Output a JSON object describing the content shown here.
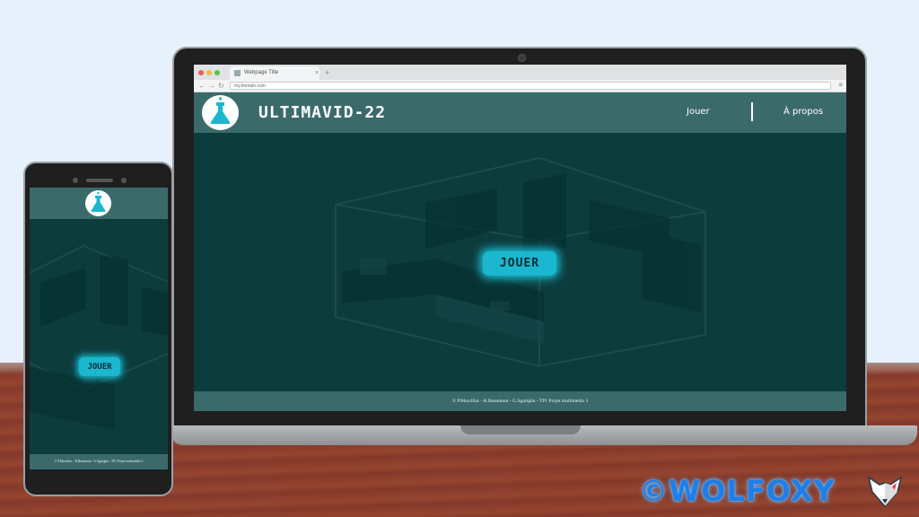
{
  "browser": {
    "tab_title": "Webpage Title",
    "url": "my.domain.com"
  },
  "site": {
    "title": "ULTIMAVID-22",
    "nav": [
      {
        "label": "Jouer"
      },
      {
        "label": "À propos"
      }
    ],
    "play_button": "JOUER",
    "footer": "© P.Marcillac - R.Beaumont - G.Sgariglia - TP1 Projet multimédia 3"
  },
  "mobile": {
    "play_button": "JOUER",
    "footer": "© P.Marcillac - R.Beaumont - G.Sgariglia - TP1 Projet multimédia 3"
  },
  "watermark": {
    "text": "©WOLFOXY"
  },
  "colors": {
    "header": "#3b6a6b",
    "background": "#0d3c3d",
    "accent_button": "#1bb7cf"
  }
}
